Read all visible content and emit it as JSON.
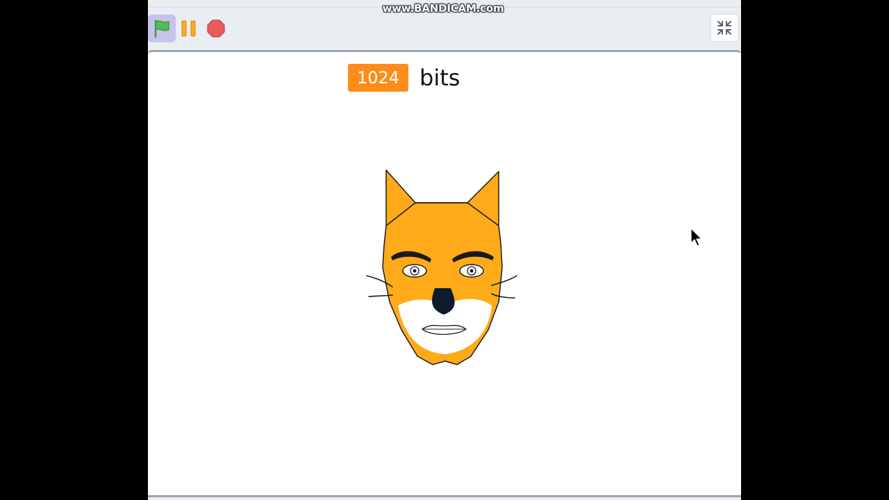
{
  "recorder": {
    "watermark": "www.BANDICAM.com"
  },
  "toolbar": {
    "green_flag_icon": "green-flag-icon",
    "pause_icon": "pause-icon",
    "stop_icon": "stop-icon",
    "fullscreen_exit_icon": "exit-fullscreen-icon",
    "colors": {
      "flag": "#4cbf56",
      "flag_active_bg": "#c7c3ec",
      "pause": "#ffab19",
      "stop": "#ec5959"
    }
  },
  "stage": {
    "monitor": {
      "value": "1024",
      "label": "bits",
      "color": "#ff8c1a"
    },
    "sprite": {
      "name": "cat-face-costume",
      "colors": {
        "fur": "#ffab19",
        "muzzle": "#ffffff",
        "nose": "#0d1b2a",
        "outline": "#1a1a1a"
      }
    }
  }
}
